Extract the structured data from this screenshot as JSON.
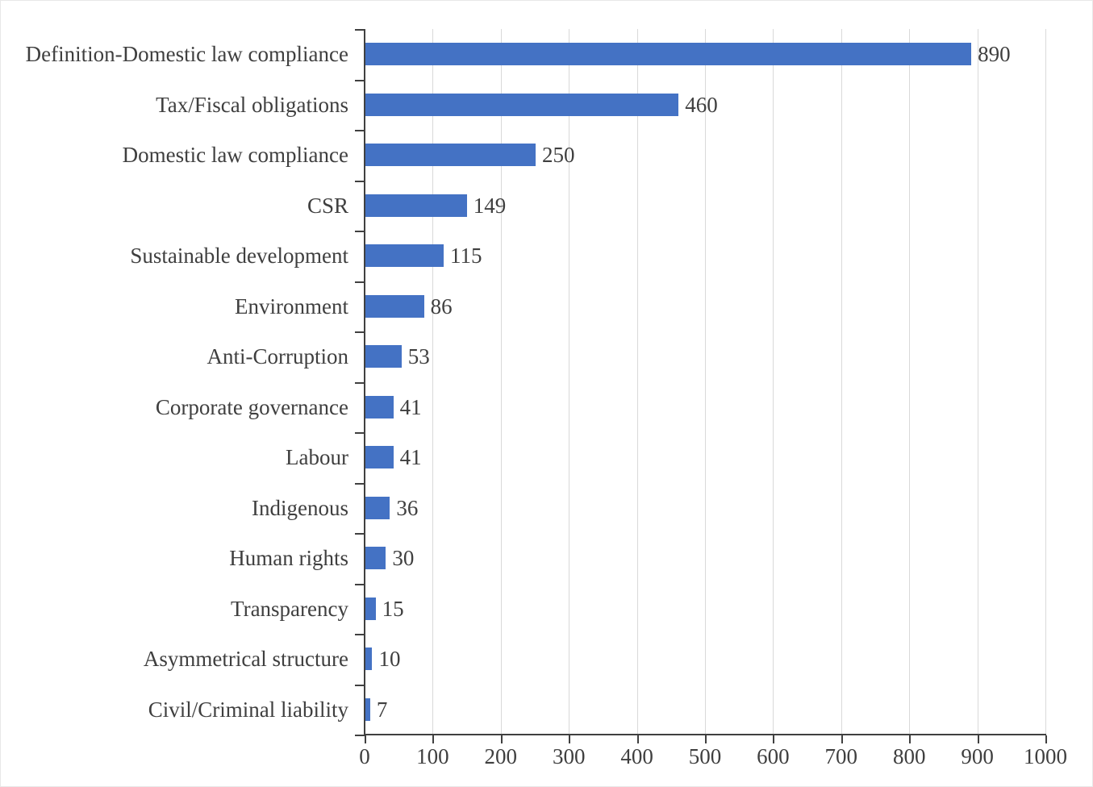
{
  "chart_data": {
    "type": "bar",
    "orientation": "horizontal",
    "title": "",
    "subtitle": "",
    "xlabel": "",
    "ylabel": "",
    "xlim": [
      0,
      1000
    ],
    "ylim": null,
    "grid": "vertical",
    "legend": "none",
    "x_ticks": [
      "0",
      "100",
      "200",
      "300",
      "400",
      "500",
      "600",
      "700",
      "800",
      "900",
      "1000"
    ],
    "x_tick_values": [
      0,
      100,
      200,
      300,
      400,
      500,
      600,
      700,
      800,
      900,
      1000
    ],
    "categories": [
      "Definition-Domestic law compliance",
      "Tax/Fiscal obligations",
      "Domestic law compliance",
      "CSR",
      "Sustainable development",
      "Environment",
      "Anti-Corruption",
      "Corporate governance",
      "Labour",
      "Indigenous",
      "Human rights",
      "Transparency",
      "Asymmetrical structure",
      "Civil/Criminal liability"
    ],
    "values": [
      890,
      460,
      250,
      149,
      115,
      86,
      53,
      41,
      41,
      36,
      30,
      15,
      10,
      7
    ],
    "data_labels": [
      "890",
      "460",
      "250",
      "149",
      "115",
      "86",
      "53",
      "41",
      "41",
      "36",
      "30",
      "15",
      "10",
      "7"
    ],
    "series": [
      {
        "name": "",
        "values": [
          890,
          460,
          250,
          149,
          115,
          86,
          53,
          41,
          41,
          36,
          30,
          15,
          10,
          7
        ]
      }
    ]
  },
  "style": {
    "bar_color": "#4472C4",
    "gridline_color": "#D9D9D9",
    "axis_color": "#404040",
    "text_color": "#3F3F3F",
    "background": "#FFFFFF"
  }
}
